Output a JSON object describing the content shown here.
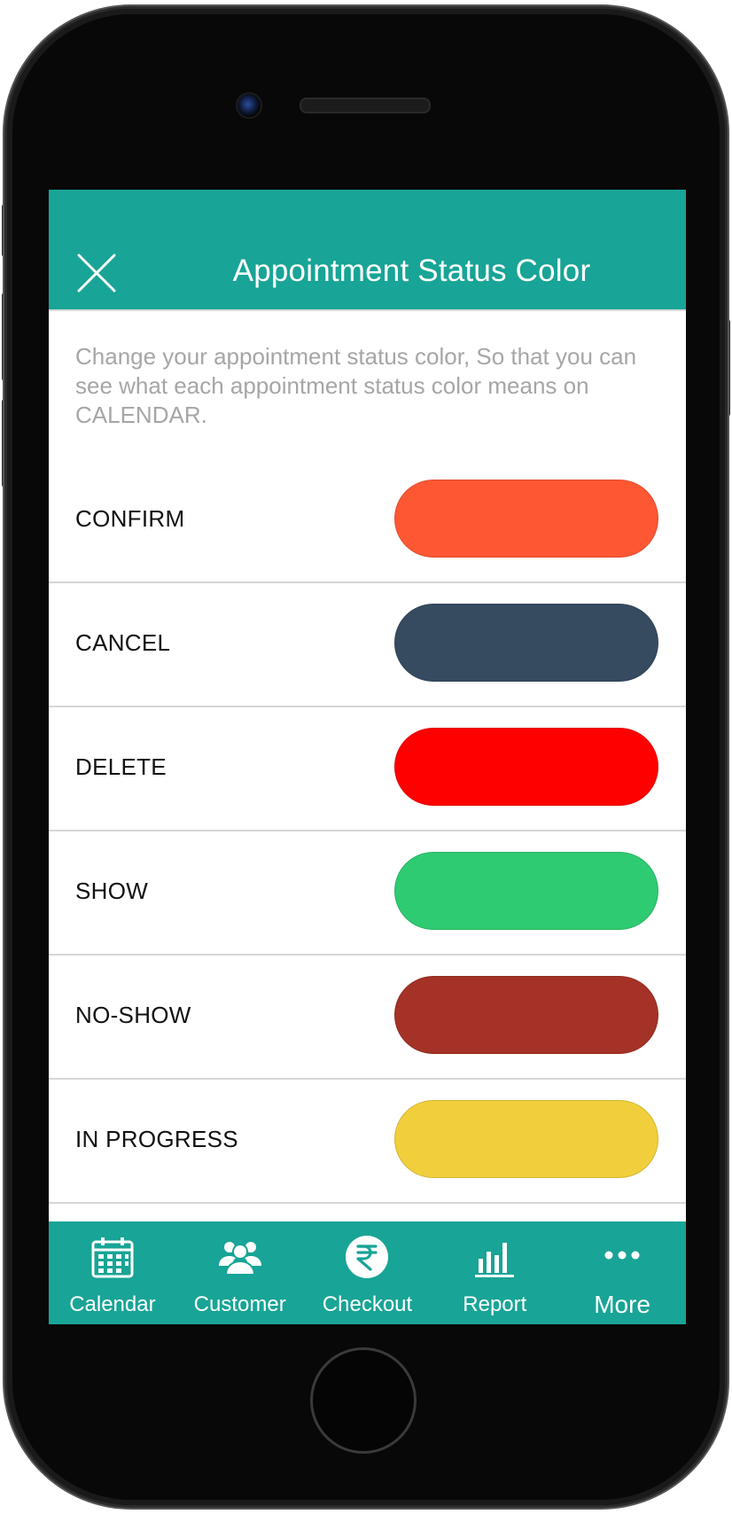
{
  "header": {
    "title": "Appointment Status Color"
  },
  "description": "Change your appointment status color, So that you can see what each appointment status color means on CALENDAR.",
  "statuses": [
    {
      "label": "CONFIRM",
      "color": "#fe5734"
    },
    {
      "label": "CANCEL",
      "color": "#364a60"
    },
    {
      "label": "DELETE",
      "color": "#ff0000"
    },
    {
      "label": "SHOW",
      "color": "#2ecb72"
    },
    {
      "label": "NO-SHOW",
      "color": "#a43227"
    },
    {
      "label": "IN PROGRESS",
      "color": "#f1cf3c"
    },
    {
      "label": "",
      "color": "#16a190"
    }
  ],
  "bottom_nav": {
    "items": [
      {
        "label": "Calendar",
        "icon": "calendar-icon"
      },
      {
        "label": "Customer",
        "icon": "customers-icon"
      },
      {
        "label": "Checkout",
        "icon": "rupee-icon"
      },
      {
        "label": "Report",
        "icon": "bar-chart-icon"
      },
      {
        "label": "More",
        "icon": "more-dots-icon"
      }
    ]
  },
  "colors": {
    "accent": "#18a496",
    "description_text": "#a6a6a6",
    "divider": "#d6d6d6"
  }
}
